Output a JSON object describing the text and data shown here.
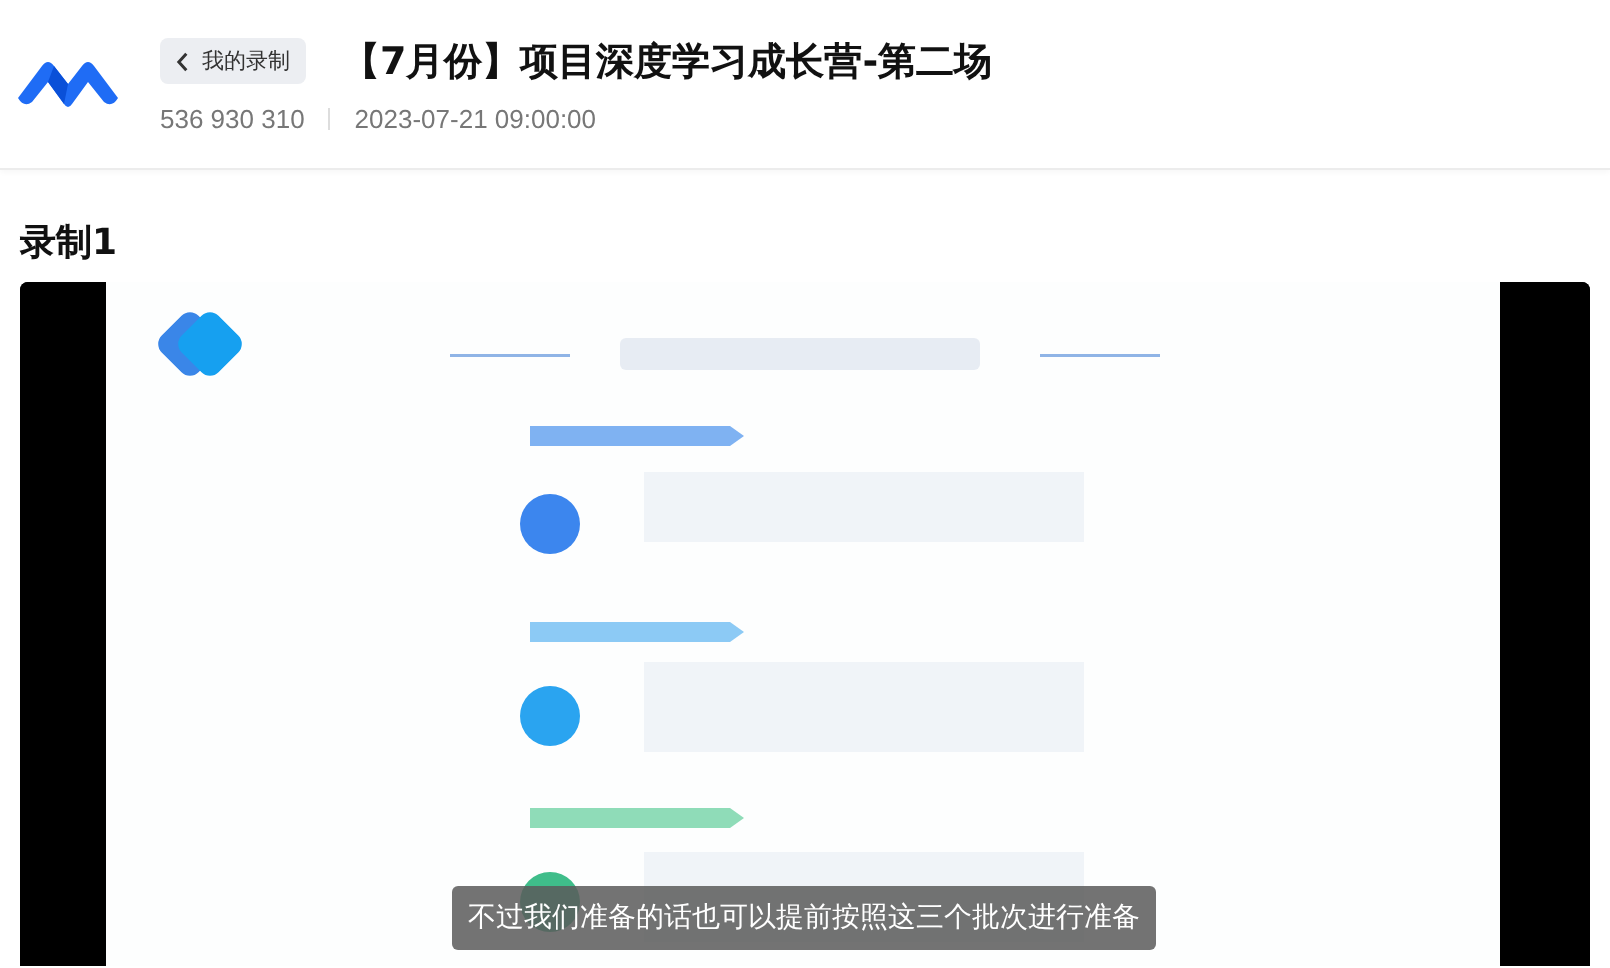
{
  "header": {
    "back_button": "我的录制",
    "title": "【7月份】项目深度学习成长营-第二场",
    "meeting_id": "536 930 310",
    "datetime": "2023-07-21 09:00:00"
  },
  "recording": {
    "title": "录制1",
    "subtitle": "不过我们准备的话也可以提前按照这三个批次进行准备"
  }
}
